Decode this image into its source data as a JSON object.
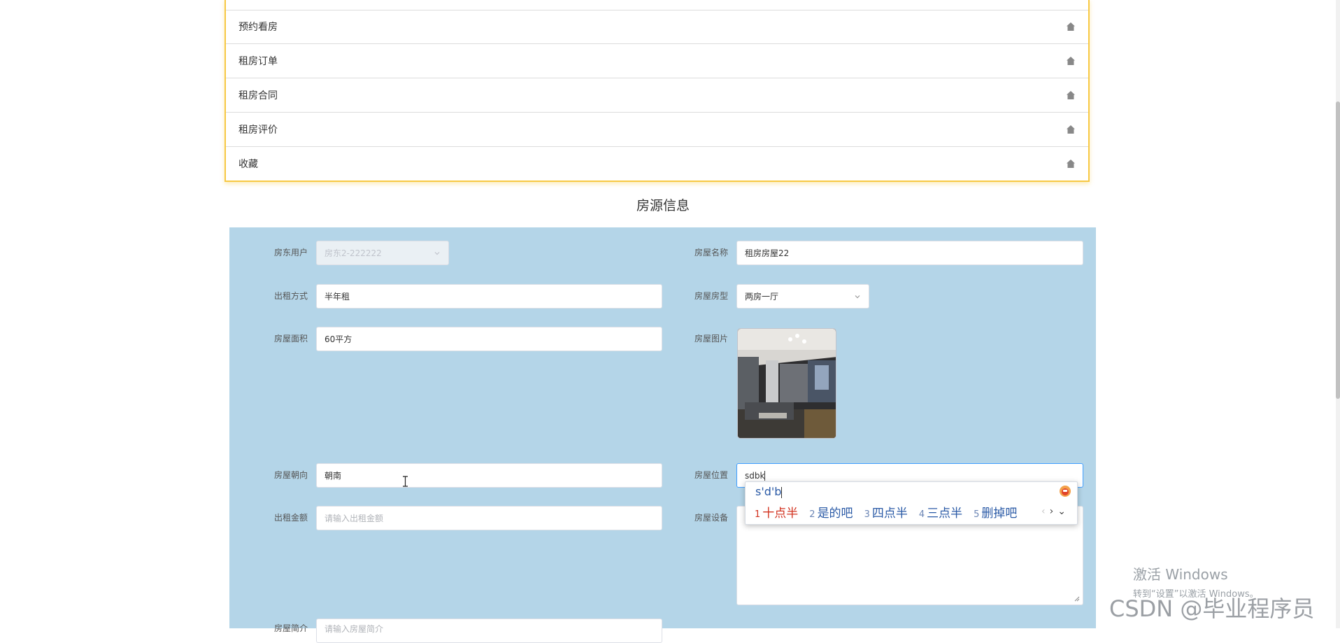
{
  "menu": {
    "items": [
      {
        "label": ""
      },
      {
        "label": "预约看房"
      },
      {
        "label": "租房订单"
      },
      {
        "label": "租房合同"
      },
      {
        "label": "租房评价"
      },
      {
        "label": "收藏"
      }
    ]
  },
  "page_title": "房源信息",
  "form": {
    "landlord": {
      "label": "房东用户",
      "value": "房东2-222222"
    },
    "house_name": {
      "label": "房屋名称",
      "value": "租房房屋22"
    },
    "rent_mode": {
      "label": "出租方式",
      "value": "半年租"
    },
    "house_type": {
      "label": "房屋房型",
      "value": "两房一厅"
    },
    "area": {
      "label": "房屋面积",
      "value": "60平方"
    },
    "photo": {
      "label": "房屋图片"
    },
    "orientation": {
      "label": "房屋朝向",
      "value": "朝南"
    },
    "location": {
      "label": "房屋位置",
      "value": "sdbk"
    },
    "price": {
      "label": "出租金额",
      "placeholder": "请输入出租金额"
    },
    "facilities": {
      "label": "房屋设备",
      "value": ""
    },
    "intro": {
      "label": "房屋简介",
      "placeholder": "请输入房屋简介"
    }
  },
  "ime": {
    "composition": "s'd'b",
    "candidates": [
      {
        "num": "1",
        "text": "十点半"
      },
      {
        "num": "2",
        "text": "是的吧"
      },
      {
        "num": "3",
        "text": "四点半"
      },
      {
        "num": "4",
        "text": "三点半"
      },
      {
        "num": "5",
        "text": "删掉吧"
      }
    ],
    "nav_prev": "‹",
    "nav_next": "›",
    "nav_more": "⌄"
  },
  "system": {
    "activate_title": "激活 Windows",
    "activate_sub": "转到“设置”以激活 Windows。",
    "watermark": "CSDN @毕业程序员"
  }
}
